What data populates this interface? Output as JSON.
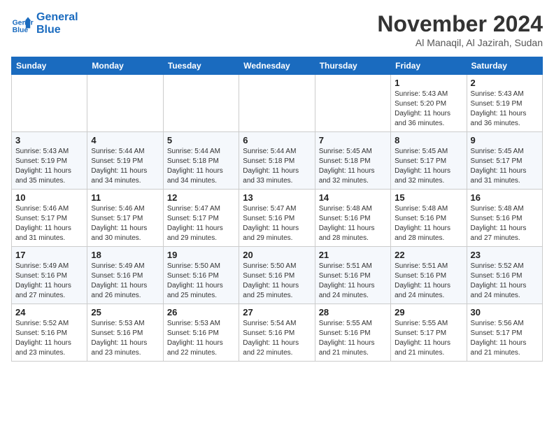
{
  "logo": {
    "line1": "General",
    "line2": "Blue"
  },
  "header": {
    "month": "November 2024",
    "location": "Al Manaqil, Al Jazirah, Sudan"
  },
  "weekdays": [
    "Sunday",
    "Monday",
    "Tuesday",
    "Wednesday",
    "Thursday",
    "Friday",
    "Saturday"
  ],
  "weeks": [
    [
      {
        "day": "",
        "info": ""
      },
      {
        "day": "",
        "info": ""
      },
      {
        "day": "",
        "info": ""
      },
      {
        "day": "",
        "info": ""
      },
      {
        "day": "",
        "info": ""
      },
      {
        "day": "1",
        "info": "Sunrise: 5:43 AM\nSunset: 5:20 PM\nDaylight: 11 hours and 36 minutes."
      },
      {
        "day": "2",
        "info": "Sunrise: 5:43 AM\nSunset: 5:19 PM\nDaylight: 11 hours and 36 minutes."
      }
    ],
    [
      {
        "day": "3",
        "info": "Sunrise: 5:43 AM\nSunset: 5:19 PM\nDaylight: 11 hours and 35 minutes."
      },
      {
        "day": "4",
        "info": "Sunrise: 5:44 AM\nSunset: 5:19 PM\nDaylight: 11 hours and 34 minutes."
      },
      {
        "day": "5",
        "info": "Sunrise: 5:44 AM\nSunset: 5:18 PM\nDaylight: 11 hours and 34 minutes."
      },
      {
        "day": "6",
        "info": "Sunrise: 5:44 AM\nSunset: 5:18 PM\nDaylight: 11 hours and 33 minutes."
      },
      {
        "day": "7",
        "info": "Sunrise: 5:45 AM\nSunset: 5:18 PM\nDaylight: 11 hours and 32 minutes."
      },
      {
        "day": "8",
        "info": "Sunrise: 5:45 AM\nSunset: 5:17 PM\nDaylight: 11 hours and 32 minutes."
      },
      {
        "day": "9",
        "info": "Sunrise: 5:45 AM\nSunset: 5:17 PM\nDaylight: 11 hours and 31 minutes."
      }
    ],
    [
      {
        "day": "10",
        "info": "Sunrise: 5:46 AM\nSunset: 5:17 PM\nDaylight: 11 hours and 31 minutes."
      },
      {
        "day": "11",
        "info": "Sunrise: 5:46 AM\nSunset: 5:17 PM\nDaylight: 11 hours and 30 minutes."
      },
      {
        "day": "12",
        "info": "Sunrise: 5:47 AM\nSunset: 5:17 PM\nDaylight: 11 hours and 29 minutes."
      },
      {
        "day": "13",
        "info": "Sunrise: 5:47 AM\nSunset: 5:16 PM\nDaylight: 11 hours and 29 minutes."
      },
      {
        "day": "14",
        "info": "Sunrise: 5:48 AM\nSunset: 5:16 PM\nDaylight: 11 hours and 28 minutes."
      },
      {
        "day": "15",
        "info": "Sunrise: 5:48 AM\nSunset: 5:16 PM\nDaylight: 11 hours and 28 minutes."
      },
      {
        "day": "16",
        "info": "Sunrise: 5:48 AM\nSunset: 5:16 PM\nDaylight: 11 hours and 27 minutes."
      }
    ],
    [
      {
        "day": "17",
        "info": "Sunrise: 5:49 AM\nSunset: 5:16 PM\nDaylight: 11 hours and 27 minutes."
      },
      {
        "day": "18",
        "info": "Sunrise: 5:49 AM\nSunset: 5:16 PM\nDaylight: 11 hours and 26 minutes."
      },
      {
        "day": "19",
        "info": "Sunrise: 5:50 AM\nSunset: 5:16 PM\nDaylight: 11 hours and 25 minutes."
      },
      {
        "day": "20",
        "info": "Sunrise: 5:50 AM\nSunset: 5:16 PM\nDaylight: 11 hours and 25 minutes."
      },
      {
        "day": "21",
        "info": "Sunrise: 5:51 AM\nSunset: 5:16 PM\nDaylight: 11 hours and 24 minutes."
      },
      {
        "day": "22",
        "info": "Sunrise: 5:51 AM\nSunset: 5:16 PM\nDaylight: 11 hours and 24 minutes."
      },
      {
        "day": "23",
        "info": "Sunrise: 5:52 AM\nSunset: 5:16 PM\nDaylight: 11 hours and 24 minutes."
      }
    ],
    [
      {
        "day": "24",
        "info": "Sunrise: 5:52 AM\nSunset: 5:16 PM\nDaylight: 11 hours and 23 minutes."
      },
      {
        "day": "25",
        "info": "Sunrise: 5:53 AM\nSunset: 5:16 PM\nDaylight: 11 hours and 23 minutes."
      },
      {
        "day": "26",
        "info": "Sunrise: 5:53 AM\nSunset: 5:16 PM\nDaylight: 11 hours and 22 minutes."
      },
      {
        "day": "27",
        "info": "Sunrise: 5:54 AM\nSunset: 5:16 PM\nDaylight: 11 hours and 22 minutes."
      },
      {
        "day": "28",
        "info": "Sunrise: 5:55 AM\nSunset: 5:16 PM\nDaylight: 11 hours and 21 minutes."
      },
      {
        "day": "29",
        "info": "Sunrise: 5:55 AM\nSunset: 5:17 PM\nDaylight: 11 hours and 21 minutes."
      },
      {
        "day": "30",
        "info": "Sunrise: 5:56 AM\nSunset: 5:17 PM\nDaylight: 11 hours and 21 minutes."
      }
    ]
  ]
}
